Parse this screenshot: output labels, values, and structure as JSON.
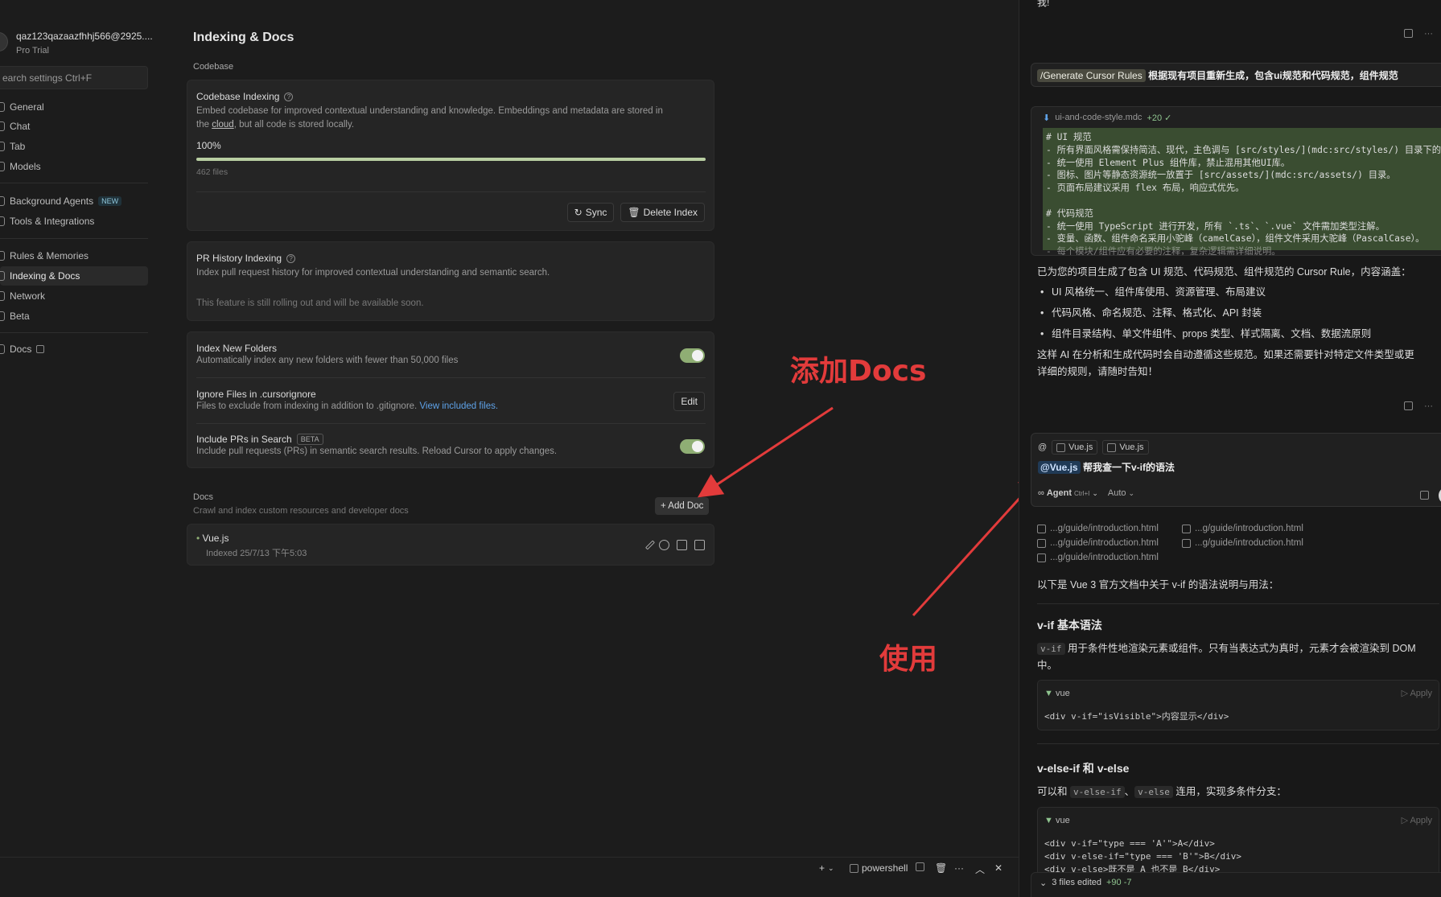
{
  "nav": {
    "account_email": "qaz123qazaazfhhj566@2925....",
    "account_plan": "Pro Trial",
    "search_placeholder": "earch settings Ctrl+F",
    "items": [
      {
        "label": "General"
      },
      {
        "label": "Chat"
      },
      {
        "label": "Tab"
      },
      {
        "label": "Models"
      },
      {
        "label": "Background Agents",
        "badge": "NEW"
      },
      {
        "label": "Tools & Integrations"
      },
      {
        "label": "Rules & Memories"
      },
      {
        "label": "Indexing & Docs",
        "active": true
      },
      {
        "label": "Network"
      },
      {
        "label": "Beta"
      },
      {
        "label": "Docs"
      }
    ]
  },
  "settings": {
    "title": "Indexing & Docs",
    "codebase_label": "Codebase",
    "codebase_indexing": {
      "title": "Codebase Indexing",
      "desc_1": "Embed codebase for improved contextual understanding and knowledge. Embeddings and metadata are stored in",
      "desc_2a": "the ",
      "desc_link": "cloud",
      "desc_2b": ", but all code is stored locally.",
      "progress_label": "100%",
      "progress_value": 1.0,
      "files": "462 files",
      "sync_label": "Sync",
      "delete_label": "Delete Index"
    },
    "pr_history": {
      "title": "PR History Indexing",
      "desc": "Index pull request history for improved contextual understanding and semantic search.",
      "note": "This feature is still rolling out and will be available soon."
    },
    "options": {
      "index_new_folders_title": "Index New Folders",
      "index_new_folders_desc": "Automatically index any new folders with fewer than 50,000 files",
      "index_new_folders_on": true,
      "ignore_title": "Ignore Files in .cursorignore",
      "ignore_desc": "Files to exclude from indexing in addition to .gitignore. ",
      "ignore_link": "View included files.",
      "edit_label": "Edit",
      "include_prs_title": "Include PRs in Search",
      "include_prs_badge": "BETA",
      "include_prs_desc": "Include pull requests (PRs) in semantic search results. Reload Cursor to apply changes.",
      "include_prs_on": true
    },
    "docs": {
      "title": "Docs",
      "desc": "Crawl and index custom resources and developer docs",
      "add_label": "+ Add Doc",
      "entries": [
        {
          "name": "Vue.js",
          "status": "Indexed 25/7/13 下午5:03"
        }
      ]
    }
  },
  "annotations": {
    "add_docs": "添加Docs",
    "use": "使用",
    "color": "#e23b3b"
  },
  "bottom_bar": {
    "terminal_label": "powershell"
  },
  "chat": {
    "top_fragment": "我!",
    "user_cmd": "/Generate Cursor Rules",
    "user_text": "根据现有项目重新生成，包含ui规范和代码规范，组件规范",
    "file_card": {
      "filename": "ui-and-code-style.mdc",
      "diff": "+20 ✓",
      "lines": [
        "# UI 规范",
        "- 所有界面风格需保持简洁、现代，主色调与 [src/styles/](mdc:src/styles/) 目录下的",
        "- 统一使用 Element Plus 组件库，禁止混用其他UI库。",
        "- 图标、图片等静态资源统一放置于 [src/assets/](mdc:src/assets/) 目录。",
        "- 页面布局建议采用 flex 布局，响应式优先。",
        "",
        "# 代码规范",
        "- 统一使用 TypeScript 进行开发，所有 `.ts`、`.vue` 文件需加类型注解。",
        "- 变量、函数、组件命名采用小驼峰（camelCase），组件文件采用大驼峰（PascalCase）。",
        "- 每个模块/组件应有必要的注释，复杂逻辑需详细说明。"
      ]
    },
    "summary_intro": "已为您的项目生成了包含 UI 规范、代码规范、组件规范的 Cursor Rule，内容涵盖：",
    "summary_bullets": [
      "UI 风格统一、组件库使用、资源管理、布局建议",
      "代码风格、命名规范、注释、格式化、API 封装",
      "组件目录结构、单文件组件、props 类型、样式隔离、文档、数据流原则"
    ],
    "summary_outro_1": "这样 AI 在分析和生成代码时会自动遵循这些规范。如果还需要针对特定文件类型或更",
    "summary_outro_2": "详细的规则，请随时告知！",
    "input": {
      "at_symbol": "@",
      "ctx_chips": [
        "Vue.js",
        "Vue.js"
      ],
      "mention": "@Vue.js",
      "text": " 帮我查一下v-if的语法",
      "mode": "Agent",
      "mode_shortcut": "Ctrl+I",
      "model": "Auto"
    },
    "refs": [
      "...g/guide/introduction.html",
      "...g/guide/introduction.html",
      "...g/guide/introduction.html",
      "...g/guide/introduction.html",
      "...g/guide/introduction.html"
    ],
    "answer_intro": "以下是 Vue 3 官方文档中关于 v-if 的语法说明与用法：",
    "h1": "v-if 基本语法",
    "p1_code": "v-if",
    "p1_a": " 用于条件性地渲染元素或组件。只有当表达式为真时，元素才会被渲染到 DOM",
    "p1_b": "中。",
    "code1_lang": "vue",
    "code1_apply": "▷ Apply",
    "code1": "<div v-if=\"isVisible\">内容显示</div>",
    "h2": "v-else-if 和 v-else",
    "p2_a": "可以和 ",
    "p2_code1": "v-else-if",
    "p2_sep": "、",
    "p2_code2": "v-else",
    "p2_b": " 连用，实现多条件分支：",
    "code2_lang": "vue",
    "code2_apply": "▷ Apply",
    "code2_lines": [
      "<div v-if=\"type === 'A'\">A</div>",
      "<div v-else-if=\"type === 'B'\">B</div>",
      "<div v-else>既不是 A 也不是 B</div>"
    ],
    "files_edited": "3 files edited",
    "files_diff": "+90 -7"
  }
}
